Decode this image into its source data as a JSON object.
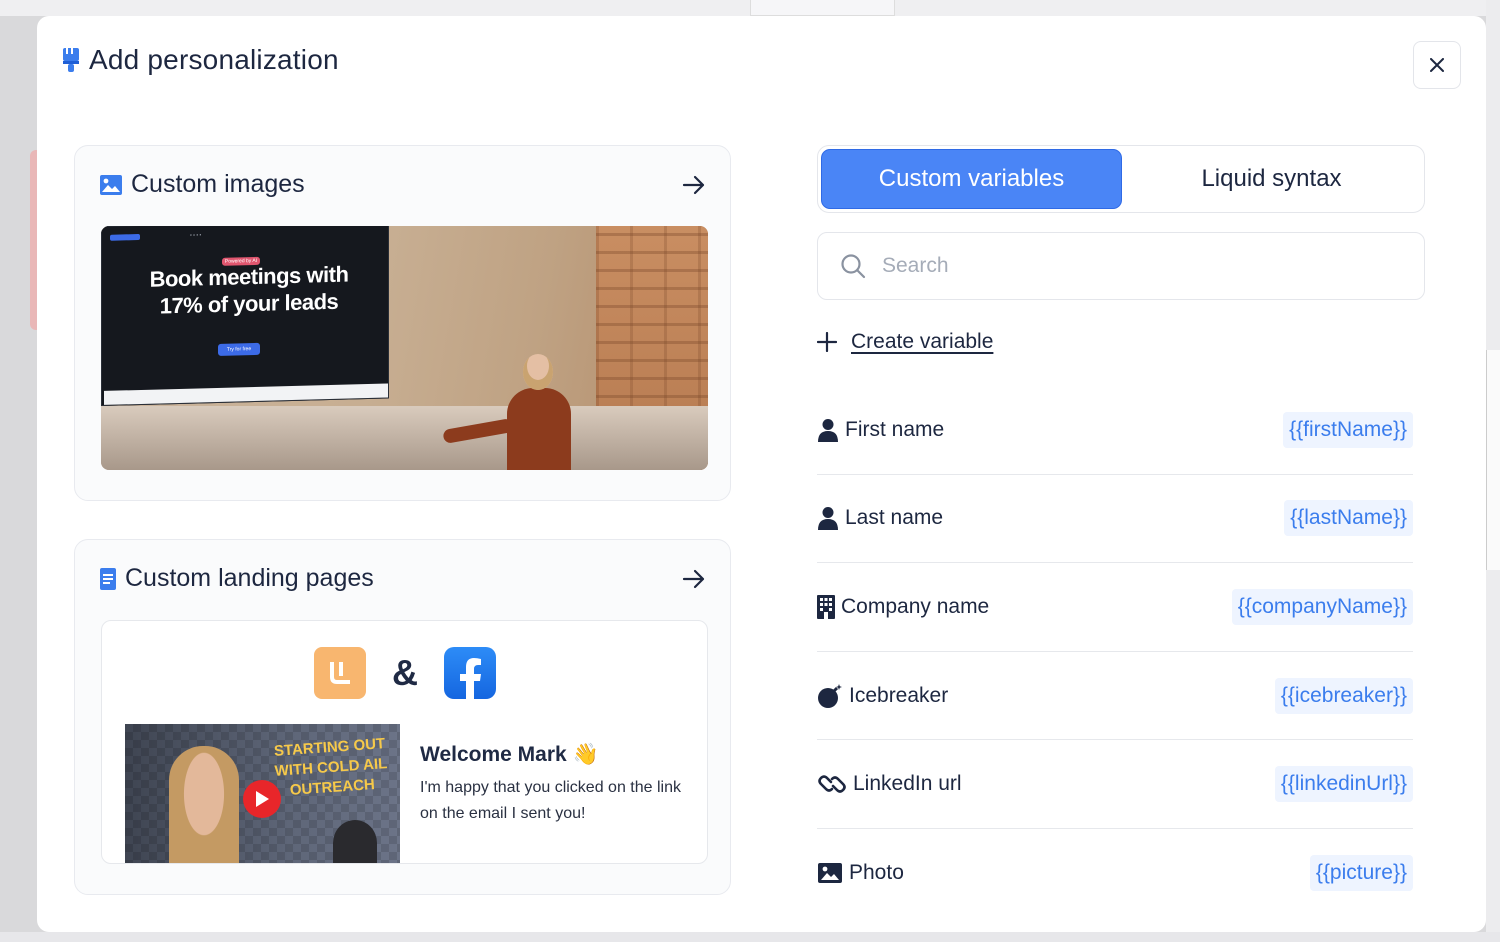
{
  "modal": {
    "title": "Add personalization",
    "close_label": "×"
  },
  "cards": {
    "images": {
      "title": "Custom images",
      "preview": {
        "headline_line1": "Book meetings with",
        "headline_line2": "17% of your leads",
        "badge": "Powered by AI",
        "cta": "Try for free"
      }
    },
    "landing": {
      "title": "Custom landing pages",
      "preview": {
        "amp": "&",
        "video_text": "STARTING OUT WITH COLD AIL OUTREACH",
        "welcome": "Welcome Mark 👋",
        "message": "I'm happy that you clicked on the link on the email I sent you!"
      }
    }
  },
  "tabs": [
    {
      "label": "Custom variables",
      "active": true
    },
    {
      "label": "Liquid syntax",
      "active": false
    }
  ],
  "search": {
    "placeholder": "Search",
    "value": ""
  },
  "create_variable": {
    "label": "Create variable"
  },
  "variables": [
    {
      "label": "First name",
      "token": "{{firstName}}",
      "icon": "user-icon"
    },
    {
      "label": "Last name",
      "token": "{{lastName}}",
      "icon": "user-icon"
    },
    {
      "label": "Company name",
      "token": "{{companyName}}",
      "icon": "building-icon"
    },
    {
      "label": "Icebreaker",
      "token": "{{icebreaker}}",
      "icon": "bomb-icon"
    },
    {
      "label": "LinkedIn url",
      "token": "{{linkedinUrl}}",
      "icon": "link-icon"
    },
    {
      "label": "Photo",
      "token": "{{picture}}",
      "icon": "image-icon"
    }
  ],
  "colors": {
    "accent": "#4a85f6",
    "token_text": "#3b7ded",
    "token_bg": "#eef4ff",
    "text": "#1d2740"
  }
}
